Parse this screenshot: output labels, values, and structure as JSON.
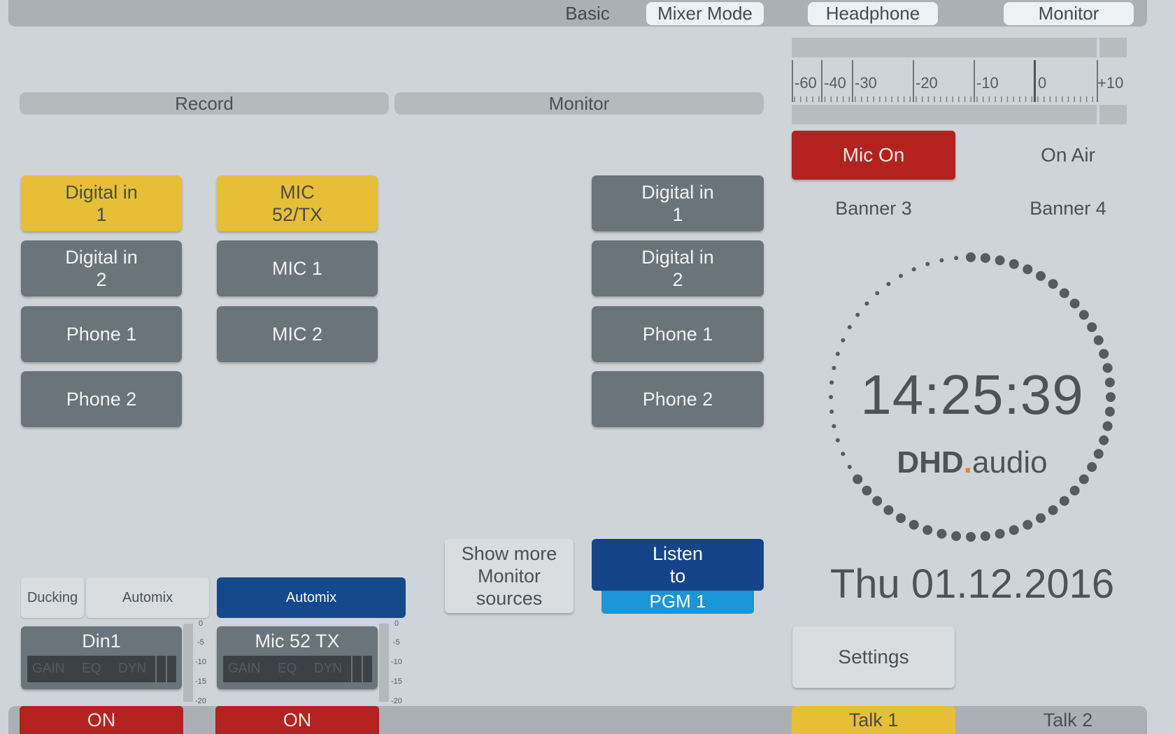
{
  "top_nav": {
    "basic": "Basic",
    "mixer_mode": "Mixer Mode",
    "headphone": "Headphone",
    "monitor": "Monitor"
  },
  "sections": {
    "record": "Record",
    "monitor": "Monitor"
  },
  "record_sources_col1": [
    "Digital in\n1",
    "Digital in\n2",
    "Phone 1",
    "Phone 2"
  ],
  "record_sources_col2": [
    "MIC\n52/TX",
    "MIC 1",
    "MIC 2"
  ],
  "monitor_sources": [
    "Digital in\n1",
    "Digital in\n2",
    "Phone 1",
    "Phone 2"
  ],
  "meter": {
    "ticks": [
      "-60",
      "-40",
      "-30",
      "-20",
      "-10",
      "0",
      "+10"
    ]
  },
  "status": {
    "mic_on": "Mic On",
    "on_air": "On Air",
    "banner3": "Banner 3",
    "banner4": "Banner 4"
  },
  "clock": {
    "time": "14:25:39",
    "brand_bold": "DHD",
    "brand_dot": ".",
    "brand_rest": "audio",
    "date": "Thu 01.12.2016",
    "seconds_elapsed": 39
  },
  "settings": "Settings",
  "controls": {
    "ducking": "Ducking",
    "automix_1": "Automix",
    "automix_2": "Automix",
    "show_more": "Show more\nMonitor\nsources",
    "listen_to": "Listen\nto",
    "pgm": "PGM 1"
  },
  "channels": [
    {
      "name": "Din1",
      "gain": "GAIN",
      "eq": "EQ",
      "dyn": "DYN",
      "on": "ON"
    },
    {
      "name": "Mic 52  TX",
      "gain": "GAIN",
      "eq": "EQ",
      "dyn": "DYN",
      "on": "ON"
    }
  ],
  "vu_scale": [
    "0",
    "-5",
    "-10",
    "-15",
    "-20"
  ],
  "talk": {
    "talk1": "Talk 1",
    "talk2": "Talk 2"
  },
  "colors": {
    "background": "#ced4d8",
    "yellow_active": "#e6bf36",
    "gray_button": "#6a747b",
    "red_on": "#b3221f",
    "blue_active": "#15488c",
    "pgm_blue": "#1b95d6",
    "brand_dot": "#e08a1e"
  }
}
